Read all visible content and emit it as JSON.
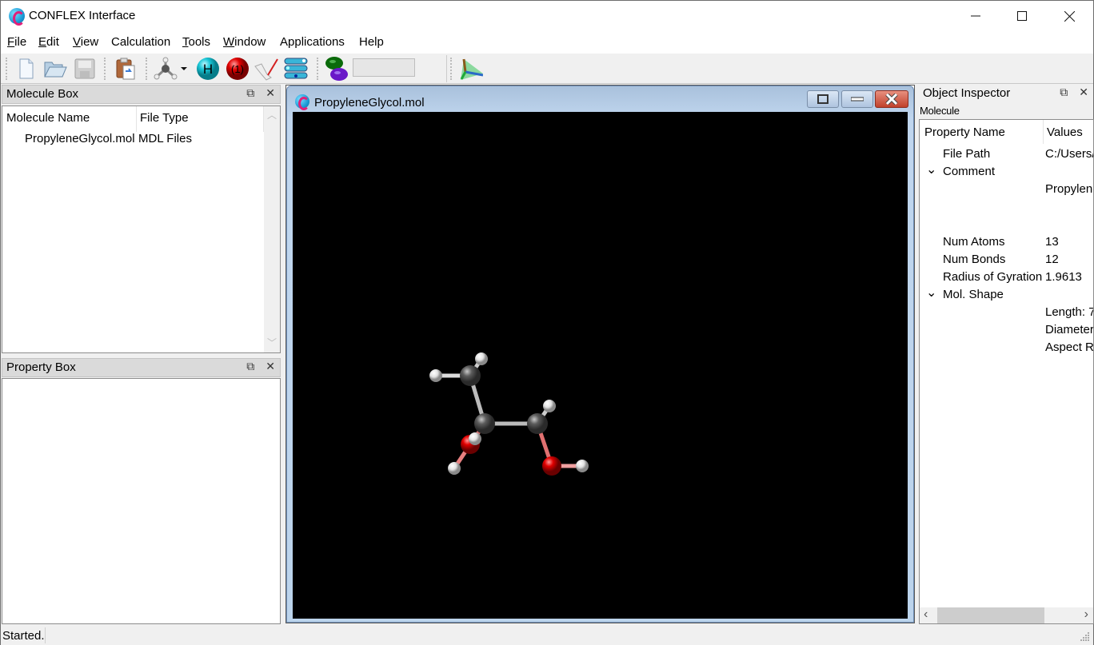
{
  "window": {
    "title": "CONFLEX Interface",
    "controls": {
      "minimize": "—",
      "maximize": "☐",
      "close": "✕"
    }
  },
  "menu": [
    {
      "label": "File",
      "accel": "F"
    },
    {
      "label": "Edit",
      "accel": "E"
    },
    {
      "label": "View",
      "accel": "V"
    },
    {
      "label": "Calculation",
      "accel": ""
    },
    {
      "label": "Tools",
      "accel": "T"
    },
    {
      "label": "Window",
      "accel": "W"
    },
    {
      "label": "Applications",
      "accel": ""
    },
    {
      "label": "Help",
      "accel": ""
    }
  ],
  "toolbar": {
    "items": [
      "new-file-icon",
      "open-folder-icon",
      "save-icon",
      "paste-clipboard-icon",
      "molecule-builder-icon",
      "add-hydrogen-icon",
      "atom-number-icon",
      "measure-icon",
      "layers-icon",
      "orbital-icon",
      "orbital-field",
      "axis-icon"
    ],
    "hydrogen_label": "H",
    "number_label": "(1)",
    "orbital_field_value": ""
  },
  "molecule_box": {
    "title": "Molecule Box",
    "columns": [
      "Molecule Name",
      "File Type"
    ],
    "rows": [
      {
        "name": "PropyleneGlycol.mol",
        "type": "MDL Files"
      }
    ]
  },
  "property_box": {
    "title": "Property Box"
  },
  "child_window": {
    "title": "PropyleneGlycol.mol",
    "viewer_background": "#000000",
    "atoms": [
      {
        "el": "C",
        "color": "#5a5a5a"
      },
      {
        "el": "C",
        "color": "#5a5a5a"
      },
      {
        "el": "C",
        "color": "#5a5a5a"
      },
      {
        "el": "O",
        "color": "#e00000"
      },
      {
        "el": "O",
        "color": "#e00000"
      },
      {
        "el": "H",
        "color": "#ffffff"
      }
    ]
  },
  "object_inspector": {
    "title": "Object Inspector",
    "subtitle": "Molecule",
    "columns": [
      "Property Name",
      "Values"
    ],
    "rows": [
      {
        "name": "File Path",
        "value": "C:/Users/",
        "expander": ""
      },
      {
        "name": "Comment",
        "value": "",
        "expander": "⌄"
      },
      {
        "name": "",
        "value": "Propylene",
        "expander": ""
      },
      {
        "name": "Num Atoms",
        "value": "13",
        "expander": ""
      },
      {
        "name": "Num Bonds",
        "value": "12",
        "expander": ""
      },
      {
        "name": "Radius of Gyration",
        "value": "1.9613",
        "expander": ""
      },
      {
        "name": "Mol. Shape",
        "value": "",
        "expander": "⌄"
      },
      {
        "name": "",
        "value": "Length: 7",
        "expander": ""
      },
      {
        "name": "",
        "value": "Diameter",
        "expander": ""
      },
      {
        "name": "",
        "value": "Aspect Ra",
        "expander": ""
      }
    ],
    "scroll_left": "‹",
    "scroll_right": "›"
  },
  "dock_controls": {
    "float": "⧉",
    "close": "✕"
  },
  "status": {
    "text": "Started."
  }
}
